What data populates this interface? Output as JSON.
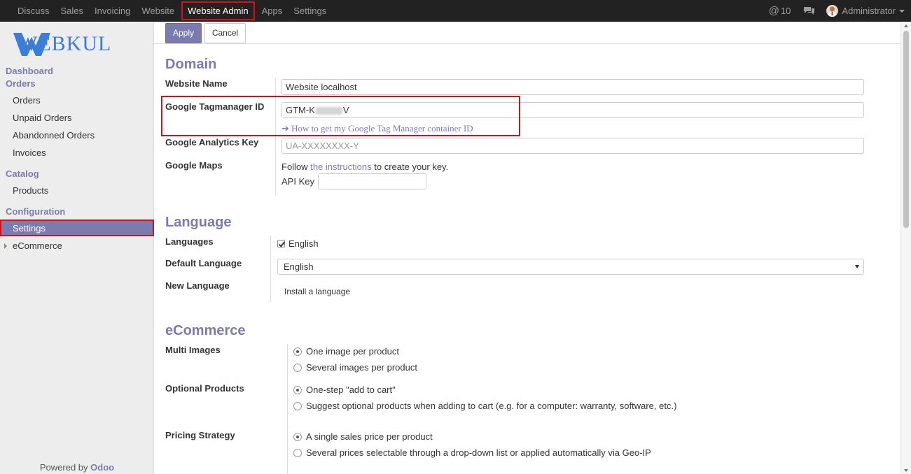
{
  "topbar": {
    "menu": [
      "Discuss",
      "Sales",
      "Invoicing",
      "Website",
      "Website Admin",
      "Apps",
      "Settings"
    ],
    "active_menu": "Website Admin",
    "mentions": "10",
    "user": "Administrator"
  },
  "sidebar": {
    "logo_text": "WEBKUL",
    "dashboard": "Dashboard",
    "orders_header": "Orders",
    "orders_items": [
      "Orders",
      "Unpaid Orders",
      "Abandonned Orders",
      "Invoices"
    ],
    "catalog_header": "Catalog",
    "catalog_items": [
      "Products"
    ],
    "configuration_header": "Configuration",
    "configuration_items": [
      "Settings"
    ],
    "ecommerce": "eCommerce",
    "powered_by": "Powered by",
    "powered_brand": "Odoo"
  },
  "actions": {
    "apply": "Apply",
    "cancel": "Cancel"
  },
  "domain": {
    "title": "Domain",
    "website_name_label": "Website Name",
    "website_name_value": "Website localhost",
    "gtm_label": "Google Tagmanager ID",
    "gtm_value_prefix": "GTM-K",
    "gtm_value_suffix": "V",
    "gtm_help_link": "How to get my Google Tag Manager container ID",
    "ga_label": "Google Analytics Key",
    "ga_placeholder": "UA-XXXXXXXX-Y",
    "maps_label": "Google Maps",
    "maps_follow": "Follow",
    "maps_link": "the instructions",
    "maps_after": "to create your key.",
    "api_key_label": "API Key",
    "api_key_value": ""
  },
  "language": {
    "title": "Language",
    "languages_label": "Languages",
    "languages_checked": "English",
    "default_label": "Default Language",
    "default_value": "English",
    "new_label": "New Language",
    "install_link": "Install a language"
  },
  "ecommerce": {
    "title": "eCommerce",
    "multi_images_label": "Multi Images",
    "multi_images_options": [
      "One image per product",
      "Several images per product"
    ],
    "multi_images_selected": 0,
    "optional_label": "Optional Products",
    "optional_options": [
      "One-step \"add to cart\"",
      "Suggest optional products when adding to cart (e.g. for a computer: warranty, software, etc.)"
    ],
    "optional_selected": 0,
    "pricing_label": "Pricing Strategy",
    "pricing_options": [
      "A single sales price per product",
      "Several prices selectable through a drop-down list or applied automatically via Geo-IP"
    ],
    "pricing_selected": 0
  },
  "colors": {
    "accent": "#7c7bad",
    "highlight": "#d0121a",
    "topbar": "#222222"
  }
}
